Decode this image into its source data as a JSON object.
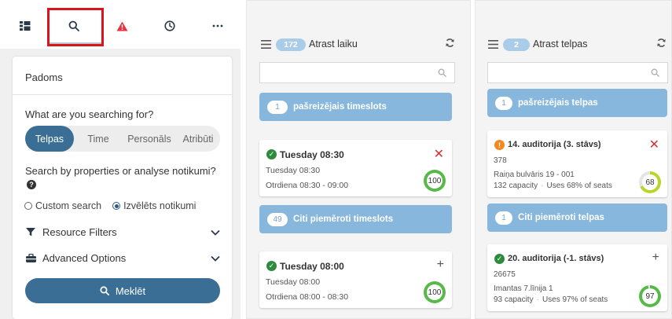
{
  "sidebar": {
    "icons": [
      "grid-icon",
      "search-icon",
      "warning-icon",
      "clock-icon",
      "more-icon"
    ],
    "active_icon": "search-icon"
  },
  "panel": {
    "title": "Padoms",
    "question1": "What are you searching for?",
    "search_types": [
      "Telpas",
      "Time",
      "Personāls",
      "Atribūti"
    ],
    "selected_type": "Telpas",
    "question2": "Search by properties or analyse notikumi?",
    "radio_custom": "Custom search",
    "radio_selected": "Izvēlēts notikumi",
    "radio_checked": "Izvēlēts notikumi",
    "resource_filters": "Resource Filters",
    "advanced_options": "Advanced Options",
    "search_button": "Meklēt"
  },
  "time_column": {
    "count": "172",
    "title": "Atrast laiku",
    "search_placeholder": "",
    "group1": {
      "count": "1",
      "label": "pašreizējais timeslots"
    },
    "group2": {
      "count": "49",
      "label": "Citi piemēroti timeslots"
    },
    "cards": [
      {
        "title": "Tuesday 08:30",
        "line1": "Tuesday 08:30",
        "line2": "Otrdiena 08:30 - 09:00",
        "score": "100",
        "action": "✕",
        "status": "ok"
      },
      {
        "title": "Tuesday 08:00",
        "line1": "Tuesday 08:00",
        "line2": "Otrdiena 08:00 - 08:30",
        "score": "100",
        "action": "+",
        "status": "ok"
      }
    ]
  },
  "room_column": {
    "count": "2",
    "title": "Atrast telpas",
    "search_placeholder": "",
    "group1": {
      "count": "1",
      "label": "pašreizējais telpas"
    },
    "group2": {
      "count": "1",
      "label": "Citi piemēroti telpas"
    },
    "cards": [
      {
        "title": "14. auditorija (3. stāvs)",
        "code": "378",
        "address": "Raiņa bulvāris 19 - 001",
        "capacity": "132 capacity",
        "uses": "Uses 68% of seats",
        "score": "68",
        "action": "✕",
        "status": "warn"
      },
      {
        "title": "20. auditorija (-1. stāvs)",
        "code": "26675",
        "address": "Imantas 7.līnija 1",
        "capacity": "93 capacity",
        "uses": "Uses 97% of seats",
        "score": "97",
        "action": "+",
        "status": "ok"
      }
    ]
  },
  "colors": {
    "primary": "#3a6e94",
    "group_bg": "#87b7dc",
    "pill": "#a9cde8",
    "ok": "#2e8b3e",
    "warn": "#f5871f",
    "remove": "#d63031",
    "score_ring": "#57b947",
    "score_ring_mid": "#b8d62a"
  }
}
